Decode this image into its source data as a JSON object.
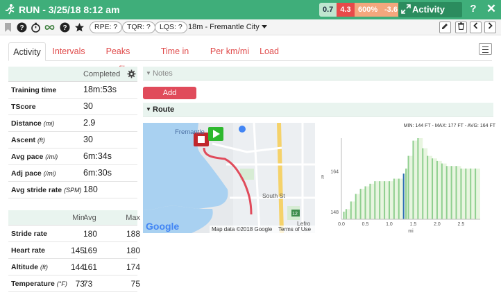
{
  "title": "RUN - 3/25/18 8:12 am",
  "badges": [
    "0.7",
    "4.3",
    "600%",
    "-3.6"
  ],
  "detail_button": "Activity detail",
  "help": "?",
  "close": "✕",
  "toolbar": {
    "rpe": "RPE: ?",
    "tqr": "TQR: ?",
    "lqs": "LQS: ?",
    "location": "18m - Fremantle City"
  },
  "tabs": [
    "Activity",
    "Intervals",
    "Peaks profile",
    "Time in zone",
    "Per km/mi",
    "Load"
  ],
  "stats": {
    "header": "Completed",
    "rows": [
      {
        "label": "Training time",
        "unit": "",
        "value": "18m:53s"
      },
      {
        "label": "TScore",
        "unit": "",
        "value": "30"
      },
      {
        "label": "Distance",
        "unit": "(mi)",
        "value": "2.9"
      },
      {
        "label": "Ascent",
        "unit": "(ft)",
        "value": "30"
      },
      {
        "label": "Avg pace",
        "unit": "(/mi)",
        "value": "6m:34s"
      },
      {
        "label": "Adj pace",
        "unit": "(/mi)",
        "value": "6m:30s"
      },
      {
        "label": "Avg stride rate",
        "unit": "(SPM)",
        "value": "180"
      }
    ]
  },
  "stats2": {
    "headers": [
      "Min",
      "Avg",
      "Max"
    ],
    "rows": [
      {
        "label": "Stride rate",
        "unit": "",
        "min": "",
        "avg": "180",
        "max": "188"
      },
      {
        "label": "Heart rate",
        "unit": "",
        "min": "145",
        "avg": "169",
        "max": "180"
      },
      {
        "label": "Altitude",
        "unit": "(ft)",
        "min": "144",
        "avg": "161",
        "max": "174"
      },
      {
        "label": "Temperature",
        "unit": "(°F)",
        "min": "73",
        "avg": "73",
        "max": "75"
      }
    ]
  },
  "sections": {
    "notes": "Notes",
    "add_comment": "Add comment...",
    "route": "Route"
  },
  "map": {
    "labels": [
      "Fremantle",
      "South St",
      "Map data ©2018 Google",
      "Terms of Use",
      "Google",
      "12",
      "Lefro"
    ]
  },
  "chart_data": {
    "type": "bar",
    "title": "MIN: 144 FT - MAX: 177 FT - AVG: 164 FT",
    "ylabel": "ft",
    "xlabel": "mi",
    "xlim": [
      0,
      2.9
    ],
    "ylim": [
      145,
      177
    ],
    "xticks": [
      "0.0",
      "0.5",
      "1.0",
      "1.5",
      "2.0",
      "2.5"
    ],
    "yticks": [
      "148",
      "164"
    ],
    "x": [
      0.05,
      0.1,
      0.2,
      0.3,
      0.4,
      0.5,
      0.6,
      0.7,
      0.8,
      0.9,
      1.0,
      1.1,
      1.2,
      1.3,
      1.35,
      1.4,
      1.5,
      1.6,
      1.7,
      1.8,
      1.9,
      2.0,
      2.1,
      2.2,
      2.3,
      2.4,
      2.5,
      2.6,
      2.7,
      2.8
    ],
    "values": [
      148,
      149,
      152,
      155,
      157,
      158,
      159,
      160,
      160,
      160,
      160,
      161,
      161,
      163,
      165,
      170,
      176,
      177,
      173,
      170,
      169,
      168,
      167,
      166,
      166,
      166,
      165,
      165,
      165,
      165
    ],
    "colors": {
      "bar": "#8fcf8f",
      "highlight": "#2e6fb5",
      "fill": "#e8f5e0"
    }
  },
  "colors": {
    "accent": "#3fae7a",
    "link": "#e04b4b",
    "button": "#e04b5b"
  }
}
